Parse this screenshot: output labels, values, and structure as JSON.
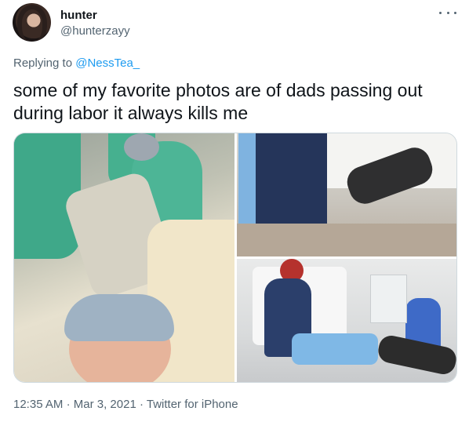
{
  "author": {
    "display_name": "hunter",
    "handle": "@hunterzayy"
  },
  "reply": {
    "prefix": "Replying to",
    "mention": "@NessTea_"
  },
  "tweet": {
    "text": "some of my favorite photos are of dads passing out during labor it always kills me"
  },
  "footer": {
    "time": "12:35 AM",
    "separator1": "·",
    "date": "Mar 3, 2021",
    "separator2": "·",
    "source": "Twitter for iPhone"
  },
  "icons": {
    "more": "more-horizontal-icon"
  },
  "colors": {
    "accent": "#1d9bf0",
    "secondary_text": "#536471",
    "primary_text": "#0f1419",
    "border": "#cfd9de"
  }
}
